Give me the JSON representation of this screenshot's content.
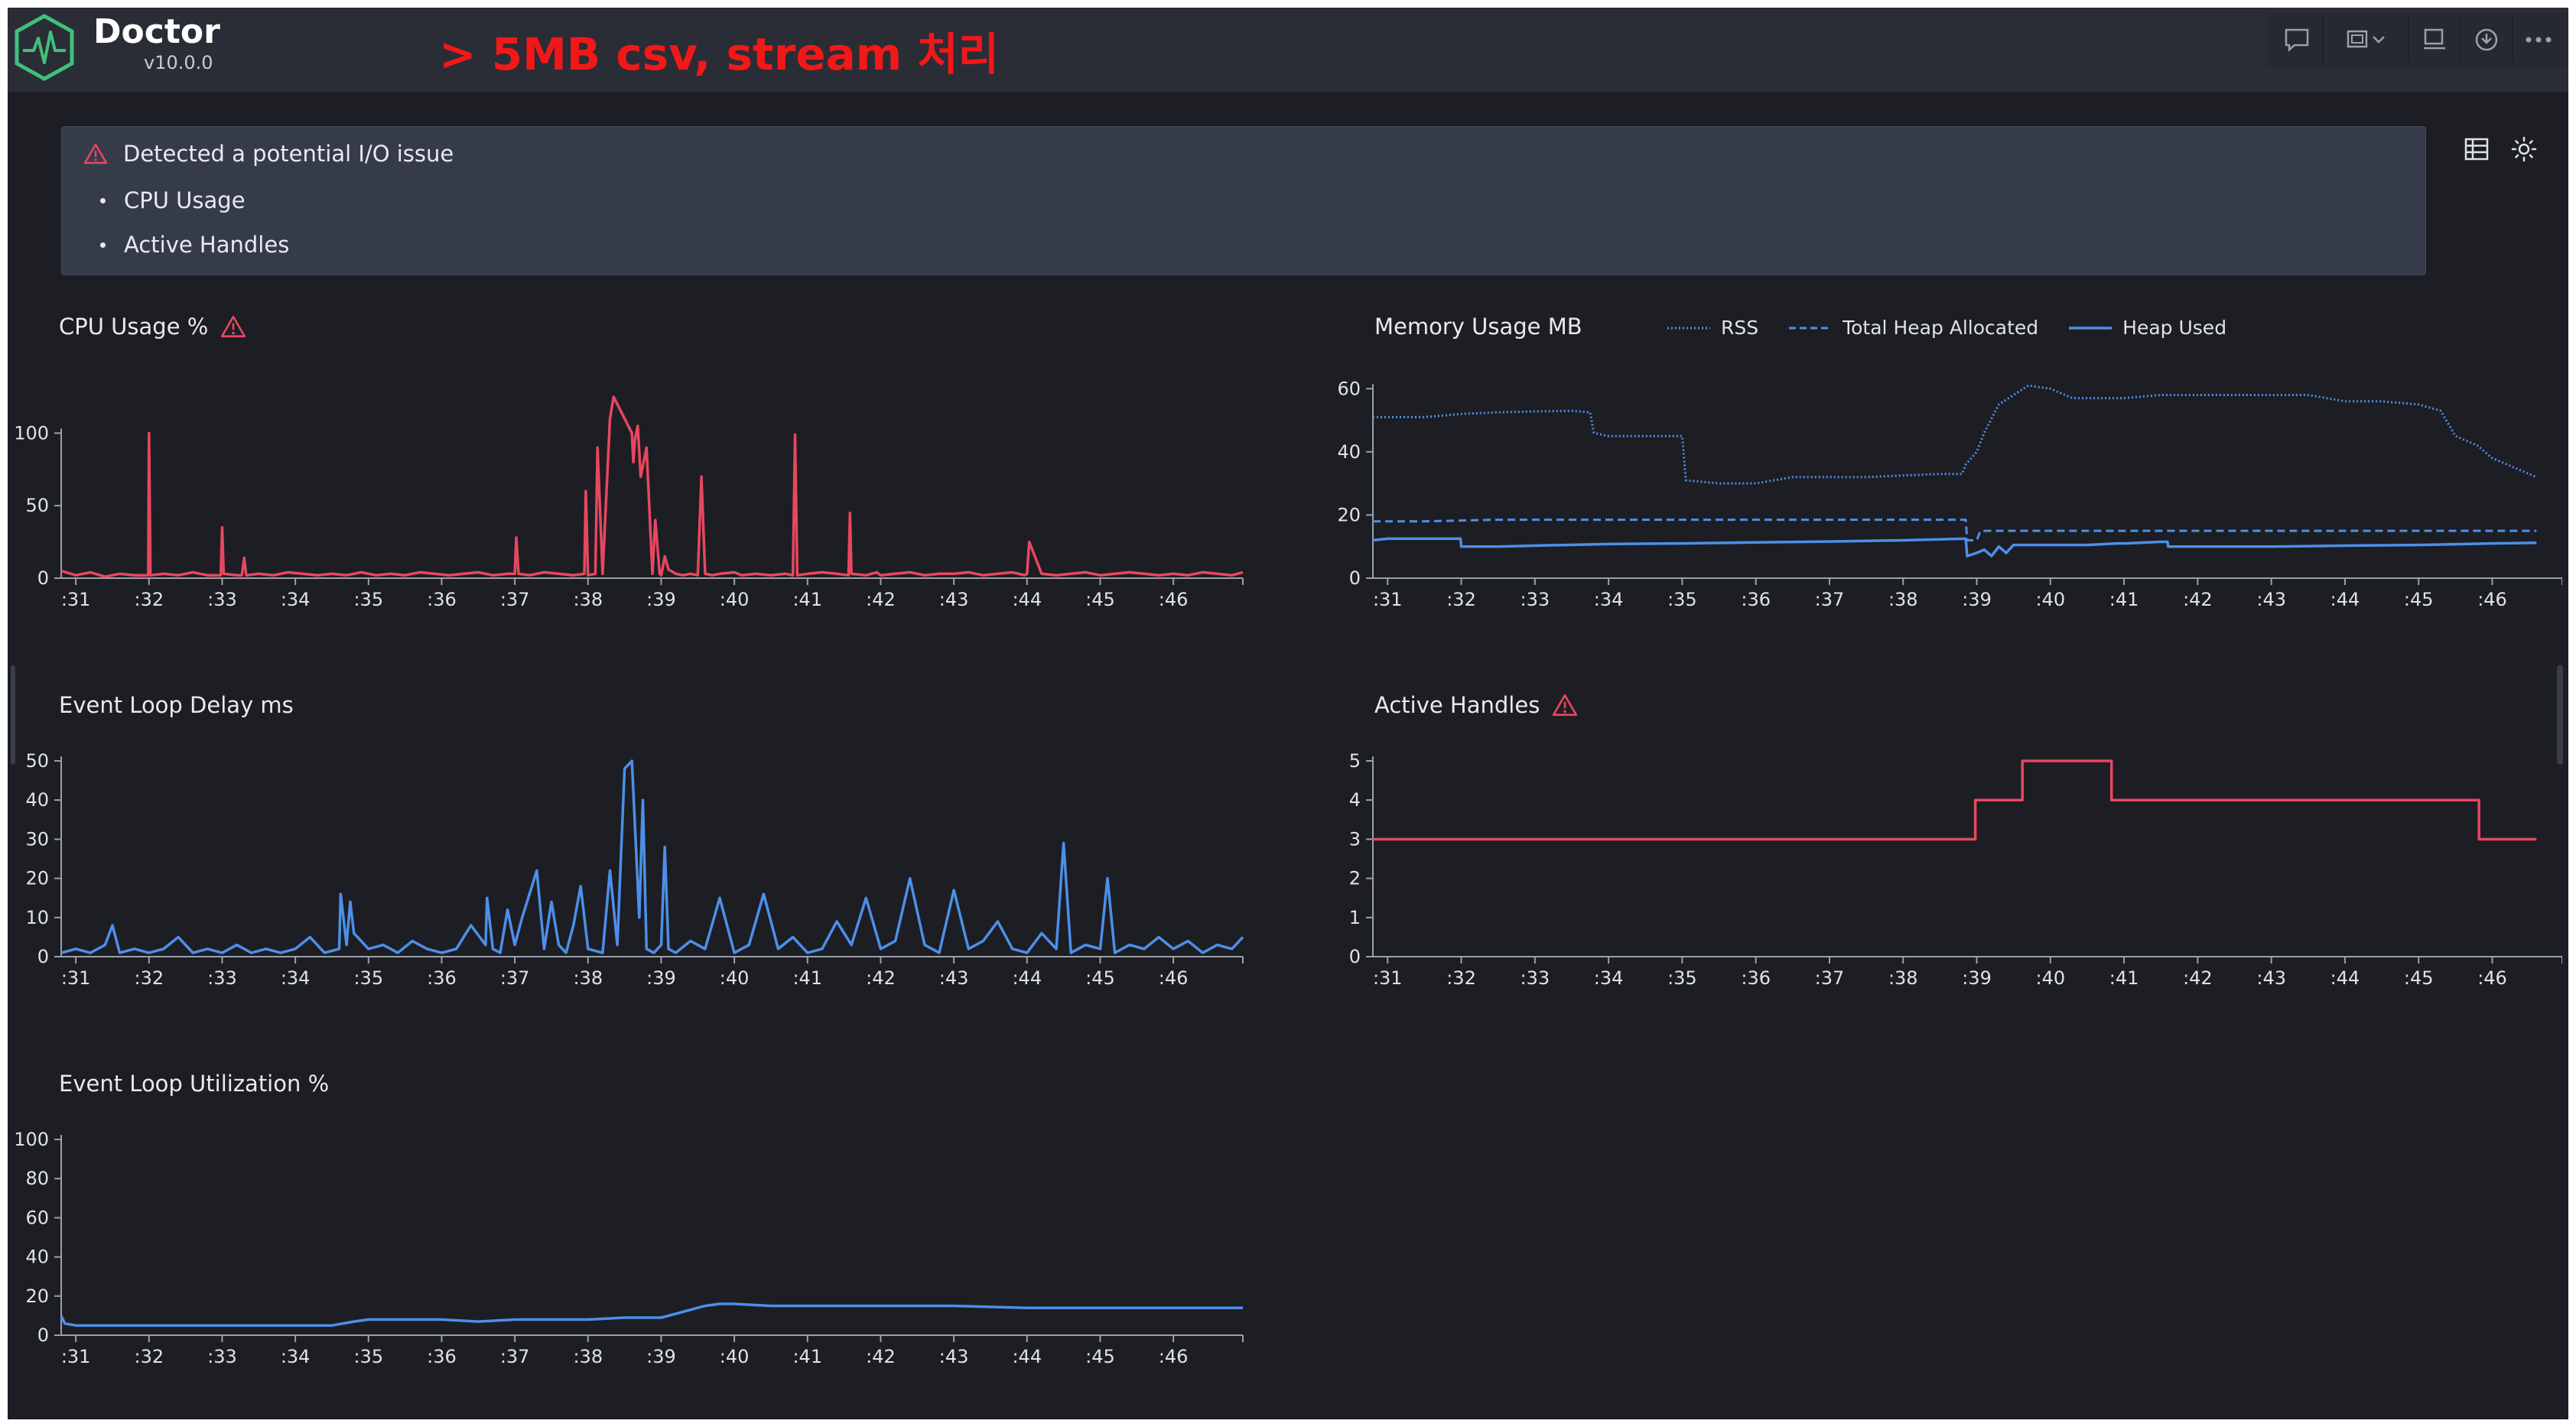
{
  "header": {
    "title": "Doctor",
    "version": "v10.0.0",
    "annotation": "> 5MB csv, stream 처리",
    "toolbar_icons": [
      "comment-icon",
      "screen-capture-icon",
      "chevron-down-icon",
      "present-icon",
      "download-icon",
      "more-icon"
    ]
  },
  "alert": {
    "title": "Detected a potential I/O issue",
    "items": [
      "CPU Usage",
      "Active Handles"
    ],
    "icon": "warning-icon"
  },
  "side_icons": [
    "table-view-icon",
    "theme-toggle-icon"
  ],
  "colors": {
    "accent_red": "#e8475f",
    "accent_blue": "#4d8fe8",
    "background": "#1c1e24",
    "panel": "#363b4a"
  },
  "time_ticks": [
    ":31",
    ":32",
    ":33",
    ":34",
    ":35",
    ":36",
    ":37",
    ":38",
    ":39",
    ":40",
    ":41",
    ":42",
    ":43",
    ":44",
    ":45",
    ":46"
  ],
  "chart_data": [
    {
      "id": "cpu",
      "type": "line",
      "title": "CPU Usage %",
      "warning": true,
      "color": "#e8475f",
      "ylim": [
        0,
        135
      ],
      "yticks": [
        0,
        50,
        100
      ],
      "x": [
        30.8,
        31.0,
        31.2,
        31.4,
        31.6,
        31.8,
        31.99,
        32.0,
        32.02,
        32.2,
        32.4,
        32.6,
        32.8,
        32.98,
        33.0,
        33.02,
        33.2,
        33.27,
        33.3,
        33.33,
        33.5,
        33.7,
        33.9,
        34.1,
        34.3,
        34.5,
        34.7,
        34.9,
        35.1,
        35.3,
        35.5,
        35.7,
        35.9,
        36.1,
        36.3,
        36.5,
        36.7,
        36.9,
        37.0,
        37.02,
        37.05,
        37.2,
        37.4,
        37.6,
        37.8,
        37.95,
        37.97,
        38.0,
        38.1,
        38.13,
        38.2,
        38.3,
        38.35,
        38.4,
        38.6,
        38.62,
        38.64,
        38.68,
        38.72,
        38.8,
        38.88,
        38.92,
        38.98,
        39.0,
        39.05,
        39.1,
        39.2,
        39.3,
        39.4,
        39.5,
        39.55,
        39.6,
        39.7,
        39.8,
        40.0,
        40.1,
        40.3,
        40.5,
        40.7,
        40.8,
        40.83,
        40.86,
        41.0,
        41.2,
        41.4,
        41.56,
        41.58,
        41.6,
        41.8,
        41.95,
        41.97,
        42.0,
        42.2,
        42.4,
        42.6,
        42.8,
        43.0,
        43.2,
        43.4,
        43.6,
        43.8,
        43.97,
        44.0,
        44.03,
        44.2,
        44.4,
        44.6,
        44.8,
        45.0,
        45.2,
        45.4,
        45.6,
        45.8,
        46.0,
        46.2,
        46.4,
        46.6,
        46.8,
        46.95
      ],
      "values": [
        5,
        2,
        4,
        1,
        3,
        2,
        2,
        100,
        2,
        3,
        2,
        4,
        2,
        2,
        35,
        3,
        2,
        2,
        14,
        2,
        3,
        2,
        4,
        3,
        2,
        3,
        2,
        4,
        2,
        3,
        2,
        4,
        3,
        2,
        3,
        4,
        2,
        3,
        3,
        28,
        3,
        2,
        4,
        3,
        2,
        3,
        60,
        2,
        3,
        90,
        3,
        110,
        125,
        120,
        100,
        80,
        95,
        105,
        70,
        90,
        3,
        40,
        3,
        2,
        15,
        6,
        3,
        2,
        3,
        2,
        70,
        3,
        2,
        3,
        4,
        2,
        3,
        2,
        3,
        2,
        99,
        2,
        3,
        4,
        3,
        2,
        45,
        3,
        2,
        4,
        3,
        2,
        3,
        4,
        2,
        3,
        3,
        4,
        2,
        3,
        4,
        2,
        3,
        25,
        3,
        2,
        3,
        4,
        2,
        3,
        4,
        3,
        2,
        3,
        2,
        4,
        3,
        2,
        4
      ],
      "xticks": [
        ":31",
        ":32",
        ":33",
        ":34",
        ":35",
        ":36",
        ":37",
        ":38",
        ":39",
        ":40",
        ":41",
        ":42",
        ":43",
        ":44",
        ":45",
        ":46"
      ]
    },
    {
      "id": "memory",
      "type": "line",
      "title": "Memory Usage MB",
      "ylim": [
        0,
        62
      ],
      "yticks": [
        0,
        20,
        40,
        60
      ],
      "legend": [
        "RSS",
        "Total Heap Allocated",
        "Heap Used"
      ],
      "series": [
        {
          "name": "RSS",
          "style": "dotted",
          "x": [
            30.8,
            31.5,
            32.0,
            32.5,
            33.0,
            33.5,
            33.75,
            33.8,
            34.0,
            34.5,
            35.0,
            35.05,
            35.5,
            36.0,
            36.5,
            37.0,
            37.5,
            38.0,
            38.5,
            38.8,
            38.85,
            39.0,
            39.1,
            39.3,
            39.5,
            39.7,
            40.0,
            40.3,
            40.5,
            41.0,
            41.5,
            42.0,
            42.5,
            43.0,
            43.5,
            44.0,
            44.5,
            45.0,
            45.3,
            45.5,
            45.8,
            46.0,
            46.3,
            46.5,
            46.6
          ],
          "values": [
            51,
            51,
            52,
            52.5,
            52.8,
            53,
            52.5,
            46,
            45,
            45,
            45,
            31,
            30,
            30,
            32,
            32,
            32,
            32.5,
            33,
            33,
            36,
            40,
            46,
            55,
            58,
            61,
            60,
            57,
            57,
            57,
            58,
            58,
            58,
            58,
            58,
            56,
            56,
            55,
            53,
            45,
            42,
            38,
            35,
            33,
            32
          ]
        },
        {
          "name": "Total Heap Allocated",
          "style": "dashed",
          "x": [
            30.8,
            31.5,
            32.5,
            33.5,
            34.5,
            35.5,
            36.5,
            37.5,
            38.5,
            38.85,
            38.87,
            39.0,
            39.05,
            39.3,
            40.0,
            41.0,
            42.0,
            43.0,
            44.0,
            45.0,
            46.0,
            46.6
          ],
          "values": [
            18,
            18,
            18.5,
            18.5,
            18.5,
            18.5,
            18.5,
            18.5,
            18.5,
            18.5,
            12,
            12,
            15,
            15,
            15,
            15,
            15,
            15,
            15,
            15,
            15,
            15
          ]
        },
        {
          "name": "Heap Used",
          "style": "solid",
          "x": [
            30.8,
            31.0,
            31.5,
            31.99,
            32.0,
            32.5,
            33.0,
            34.0,
            35.0,
            36.0,
            37.0,
            38.0,
            38.5,
            38.85,
            38.87,
            39.0,
            39.1,
            39.2,
            39.3,
            39.4,
            39.5,
            40.0,
            40.5,
            40.9,
            41.0,
            41.5,
            41.59,
            41.6,
            42.0,
            43.0,
            44.0,
            45.0,
            46.0,
            46.6
          ],
          "values": [
            12,
            12.5,
            12.5,
            12.5,
            10,
            10,
            10.3,
            10.8,
            11,
            11.3,
            11.6,
            12,
            12.3,
            12.5,
            7,
            8,
            9,
            7,
            10,
            8,
            10.5,
            10.5,
            10.5,
            11,
            11,
            11.5,
            11.5,
            10,
            10,
            10,
            10.3,
            10.5,
            11,
            11.2
          ]
        }
      ],
      "color": "#4d8fe8",
      "xticks": [
        ":31",
        ":32",
        ":33",
        ":34",
        ":35",
        ":36",
        ":37",
        ":38",
        ":39",
        ":40",
        ":41",
        ":42",
        ":43",
        ":44",
        ":45",
        ":46"
      ]
    },
    {
      "id": "eld",
      "type": "line",
      "title": "Event Loop Delay ms",
      "color": "#4d8fe8",
      "ylim": [
        0,
        50
      ],
      "yticks": [
        0,
        10,
        20,
        30,
        40,
        50
      ],
      "x": [
        30.8,
        31.0,
        31.2,
        31.4,
        31.5,
        31.6,
        31.8,
        32.0,
        32.2,
        32.4,
        32.6,
        32.8,
        33.0,
        33.2,
        33.4,
        33.6,
        33.8,
        34.0,
        34.2,
        34.4,
        34.6,
        34.62,
        34.7,
        34.75,
        34.8,
        35.0,
        35.2,
        35.4,
        35.6,
        35.8,
        36.0,
        36.2,
        36.4,
        36.6,
        36.62,
        36.7,
        36.8,
        36.9,
        37.0,
        37.1,
        37.2,
        37.3,
        37.4,
        37.5,
        37.6,
        37.7,
        37.8,
        37.9,
        38.0,
        38.2,
        38.3,
        38.4,
        38.5,
        38.6,
        38.7,
        38.75,
        38.8,
        38.9,
        39.0,
        39.05,
        39.1,
        39.2,
        39.4,
        39.6,
        39.8,
        40.0,
        40.2,
        40.4,
        40.6,
        40.8,
        41.0,
        41.2,
        41.4,
        41.6,
        41.8,
        42.0,
        42.2,
        42.4,
        42.6,
        42.8,
        43.0,
        43.2,
        43.4,
        43.6,
        43.8,
        44.0,
        44.2,
        44.4,
        44.5,
        44.6,
        44.8,
        45.0,
        45.1,
        45.2,
        45.4,
        45.6,
        45.8,
        46.0,
        46.2,
        46.4,
        46.6,
        46.8,
        46.95
      ],
      "values": [
        1,
        2,
        1,
        3,
        8,
        1,
        2,
        1,
        2,
        5,
        1,
        2,
        1,
        3,
        1,
        2,
        1,
        2,
        5,
        1,
        2,
        16,
        3,
        14,
        6,
        2,
        3,
        1,
        4,
        2,
        1,
        2,
        8,
        3,
        15,
        2,
        1,
        12,
        3,
        10,
        16,
        22,
        2,
        14,
        3,
        1,
        8,
        18,
        2,
        1,
        22,
        3,
        48,
        50,
        10,
        40,
        2,
        1,
        3,
        28,
        2,
        1,
        4,
        2,
        15,
        1,
        3,
        16,
        2,
        5,
        1,
        2,
        9,
        3,
        15,
        2,
        4,
        20,
        3,
        1,
        17,
        2,
        4,
        9,
        2,
        1,
        6,
        2,
        29,
        1,
        3,
        2,
        20,
        1,
        3,
        2,
        5,
        2,
        4,
        1,
        3,
        2,
        5
      ],
      "xticks": [
        ":31",
        ":32",
        ":33",
        ":34",
        ":35",
        ":36",
        ":37",
        ":38",
        ":39",
        ":40",
        ":41",
        ":42",
        ":43",
        ":44",
        ":45",
        ":46"
      ]
    },
    {
      "id": "handles",
      "type": "line",
      "step": true,
      "title": "Active Handles",
      "warning": true,
      "color": "#e8475f",
      "ylim": [
        0,
        5
      ],
      "yticks": [
        0,
        1,
        2,
        3,
        4,
        5
      ],
      "x": [
        30.8,
        38.98,
        39.62,
        40.83,
        45.82,
        46.6
      ],
      "values": [
        3,
        4,
        5,
        4,
        3,
        3
      ],
      "xticks": [
        ":31",
        ":32",
        ":33",
        ":34",
        ":35",
        ":36",
        ":37",
        ":38",
        ":39",
        ":40",
        ":41",
        ":42",
        ":43",
        ":44",
        ":45",
        ":46"
      ]
    },
    {
      "id": "elu",
      "type": "line",
      "title": "Event Loop Utilization %",
      "color": "#4d8fe8",
      "ylim": [
        0,
        100
      ],
      "yticks": [
        0,
        20,
        40,
        60,
        80,
        100
      ],
      "x": [
        30.8,
        30.85,
        31.0,
        31.5,
        32.0,
        32.5,
        33.0,
        34.0,
        34.5,
        34.8,
        35.0,
        35.5,
        36.0,
        36.5,
        37.0,
        37.5,
        38.0,
        38.5,
        39.0,
        39.3,
        39.6,
        39.8,
        40.0,
        40.5,
        41.0,
        42.0,
        43.0,
        44.0,
        45.0,
        46.0,
        46.95
      ],
      "values": [
        10,
        6,
        5,
        5,
        5,
        5,
        5,
        5,
        5,
        7,
        8,
        8,
        8,
        7,
        8,
        8,
        8,
        9,
        9,
        12,
        15,
        16,
        16,
        15,
        15,
        15,
        15,
        14,
        14,
        14,
        14
      ],
      "xticks": [
        ":31",
        ":32",
        ":33",
        ":34",
        ":35",
        ":36",
        ":37",
        ":38",
        ":39",
        ":40",
        ":41",
        ":42",
        ":43",
        ":44",
        ":45",
        ":46"
      ]
    }
  ]
}
